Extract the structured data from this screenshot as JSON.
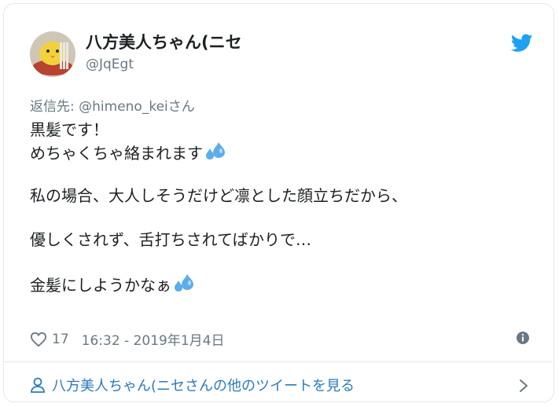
{
  "tweet": {
    "display_name": "八方美人ちゃん(ニセ",
    "handle": "@JqEgt",
    "reply_prefix": "返信先: ",
    "reply_to": "@himeno_kei",
    "reply_suffix": "さん",
    "lines": [
      "黒髪です！",
      "めちゃくちゃ絡まれます",
      "",
      "私の場合、大人しそうだけど凛とした顔立ちだから、",
      "",
      "優しくされず、舌打ちされてばかりで…",
      "",
      "金髪にしようかなぁ"
    ],
    "emojis": [
      "sweat-droplets-icon"
    ],
    "like_count": "17",
    "timestamp": "16:32 - 2019年1月4日",
    "footer_link": "八方美人ちゃん(ニセさんの他のツイートを見る"
  },
  "colors": {
    "text": "#1c2022",
    "secondary": "#697882",
    "link": "#2b7bb9",
    "twitter_blue": "#1da1f2",
    "emoji_blue": "#5dadec",
    "border": "#e1e8ed"
  }
}
